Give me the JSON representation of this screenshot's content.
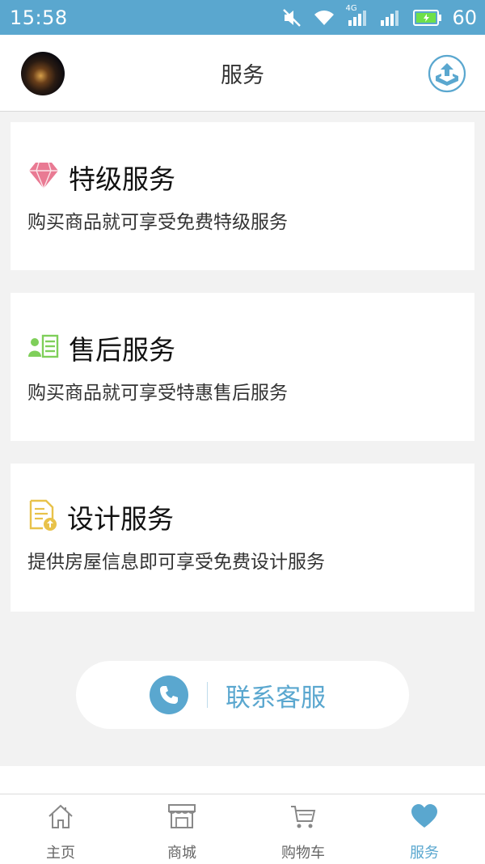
{
  "status_bar": {
    "time": "15:58",
    "network": "4G",
    "battery": "60"
  },
  "header": {
    "title": "服务"
  },
  "services": [
    {
      "title": "特级服务",
      "desc": "购买商品就可享受免费特级服务",
      "icon": "diamond-icon"
    },
    {
      "title": "售后服务",
      "desc": "购买商品就可享受特惠售后服务",
      "icon": "contact-card-icon"
    },
    {
      "title": "设计服务",
      "desc": "提供房屋信息即可享受免费设计服务",
      "icon": "document-upload-icon"
    }
  ],
  "contact": {
    "label": "联系客服",
    "icon": "phone-icon"
  },
  "tabs": [
    {
      "label": "主页",
      "icon": "home-icon"
    },
    {
      "label": "商城",
      "icon": "store-icon"
    },
    {
      "label": "购物车",
      "icon": "cart-icon"
    },
    {
      "label": "服务",
      "icon": "heart-icon",
      "active": true
    }
  ],
  "colors": {
    "accent": "#5aa7cf",
    "diamond": "#e97a93",
    "contact_card": "#7fcf5a",
    "document": "#e8c24a"
  }
}
